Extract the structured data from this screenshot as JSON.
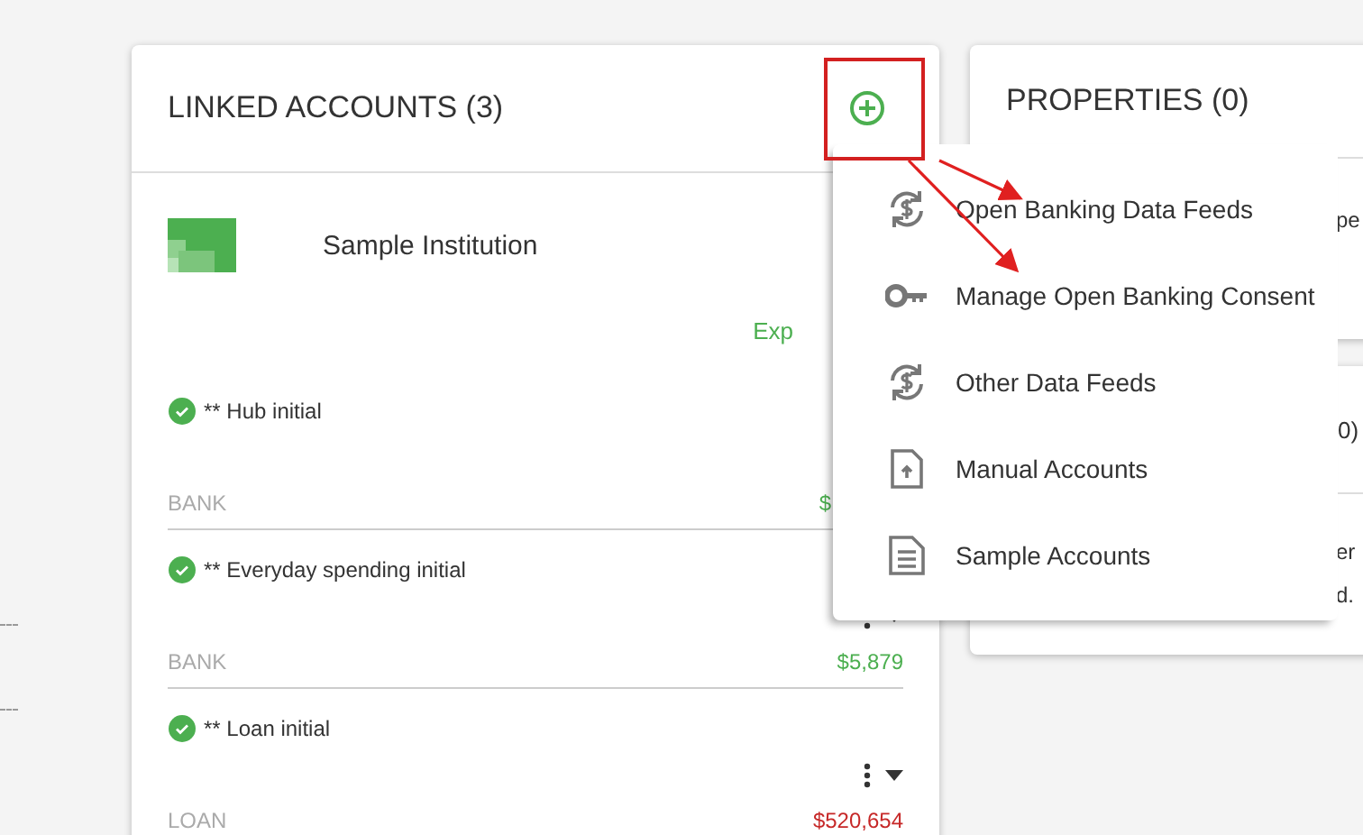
{
  "linked_accounts": {
    "title": "LINKED ACCOUNTS (3)",
    "institution": {
      "name": "Sample Institution",
      "status": "Exp"
    },
    "accounts": [
      {
        "name": "** Hub initial",
        "connected": true,
        "type": "BANK",
        "amount": "$",
        "color": "#4caf50",
        "actions": false
      },
      {
        "name": "** Everyday spending initial",
        "connected": true,
        "type": "BANK",
        "amount": "$5,879",
        "color": "#4caf50",
        "actions": true
      },
      {
        "name": "** Loan initial",
        "connected": true,
        "type": "LOAN",
        "amount": "$520,654",
        "color": "#c62828",
        "actions": true
      }
    ]
  },
  "properties": {
    "title": "PROPERTIES (0)",
    "text": "pe"
  },
  "second_card": {
    "title": "0)",
    "lines": [
      "er",
      "d."
    ]
  },
  "add_menu": {
    "items": [
      {
        "kind": "sync",
        "label": "Open Banking Data Feeds"
      },
      {
        "kind": "key",
        "label": "Manage Open Banking Consent"
      },
      {
        "kind": "sync",
        "label": "Other Data Feeds"
      },
      {
        "kind": "upload",
        "label": "Manual Accounts"
      },
      {
        "kind": "document",
        "label": "Sample Accounts"
      }
    ]
  }
}
